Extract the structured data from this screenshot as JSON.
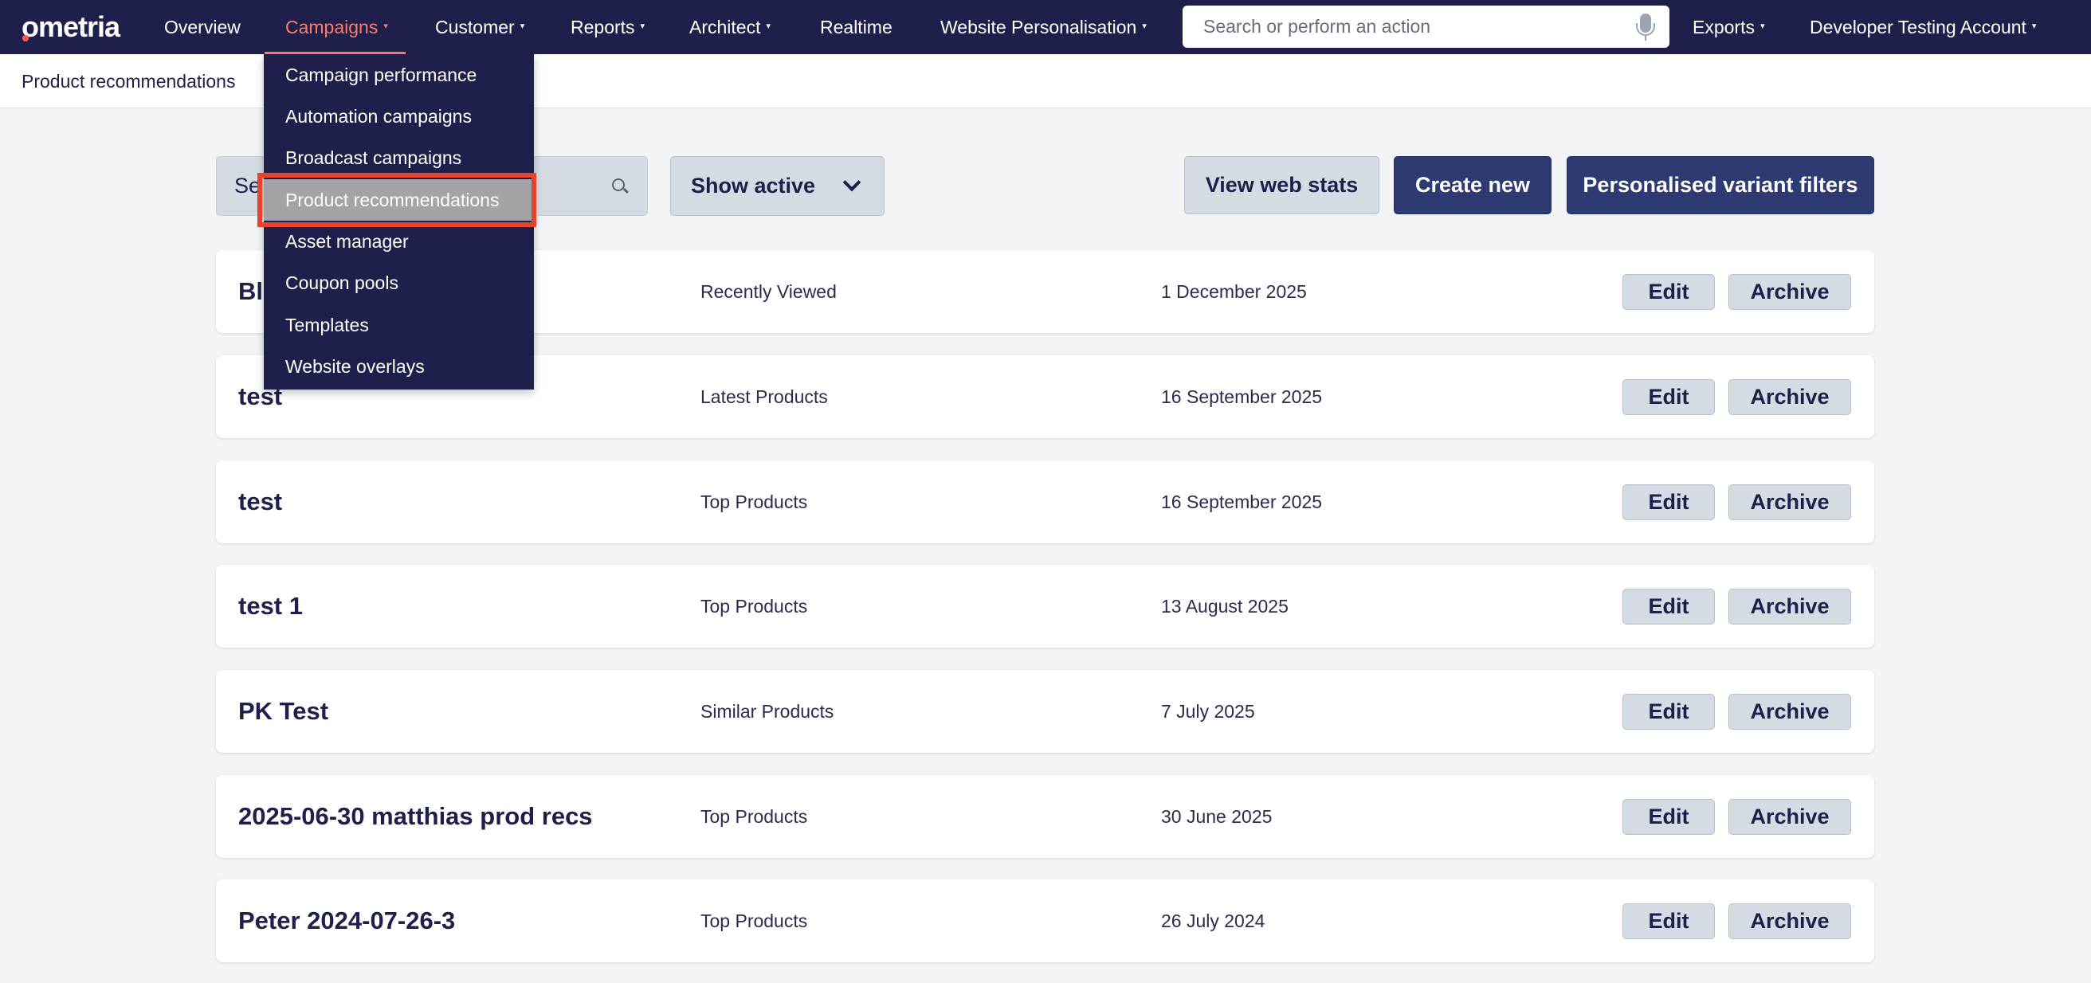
{
  "nav": {
    "logo": "ometria",
    "items": [
      {
        "label": "Overview",
        "caret": false
      },
      {
        "label": "Campaigns",
        "caret": true,
        "active": true
      },
      {
        "label": "Customer",
        "caret": true
      },
      {
        "label": "Reports",
        "caret": true
      },
      {
        "label": "Architect",
        "caret": true
      },
      {
        "label": "Realtime",
        "caret": false
      },
      {
        "label": "Website Personalisation",
        "caret": true
      }
    ],
    "search_placeholder": "Search or perform an action",
    "exports": "Exports",
    "account": "Developer Testing Account",
    "active_color": "#ff7a6b"
  },
  "subheader": {
    "title": "Product recommendations"
  },
  "toolbar": {
    "search_value": "Se",
    "filter_value": "Show active",
    "view_web_stats": "View web stats",
    "create_new": "Create new",
    "personalised_filters": "Personalised variant filters"
  },
  "rows": [
    {
      "name": "Bl",
      "type": "Recently Viewed",
      "date": "1 December 2025"
    },
    {
      "name": "test",
      "type": "Latest Products",
      "date": "16 September 2025"
    },
    {
      "name": "test",
      "type": "Top Products",
      "date": "16 September 2025"
    },
    {
      "name": "test 1",
      "type": "Top Products",
      "date": "13 August 2025"
    },
    {
      "name": "PK Test",
      "type": "Similar Products",
      "date": "7 July 2025"
    },
    {
      "name": "2025-06-30 matthias prod recs",
      "type": "Top Products",
      "date": "30 June 2025"
    },
    {
      "name": "Peter 2024-07-26-3",
      "type": "Top Products",
      "date": "26 July 2024"
    }
  ],
  "row_actions": {
    "edit": "Edit",
    "archive": "Archive"
  },
  "dropdown": {
    "items": [
      "Campaign performance",
      "Automation campaigns",
      "Broadcast campaigns",
      "Product recommendations",
      "Asset manager",
      "Coupon pools",
      "Templates",
      "Website overlays"
    ],
    "highlighted_index": 3,
    "highlight_outline_color": "#e8412c"
  },
  "colors": {
    "nav_bg": "#1f1f4b",
    "primary_button": "#2e3b72",
    "secondary_button": "#d5dbe3",
    "page_bg": "#f3f4f6"
  }
}
